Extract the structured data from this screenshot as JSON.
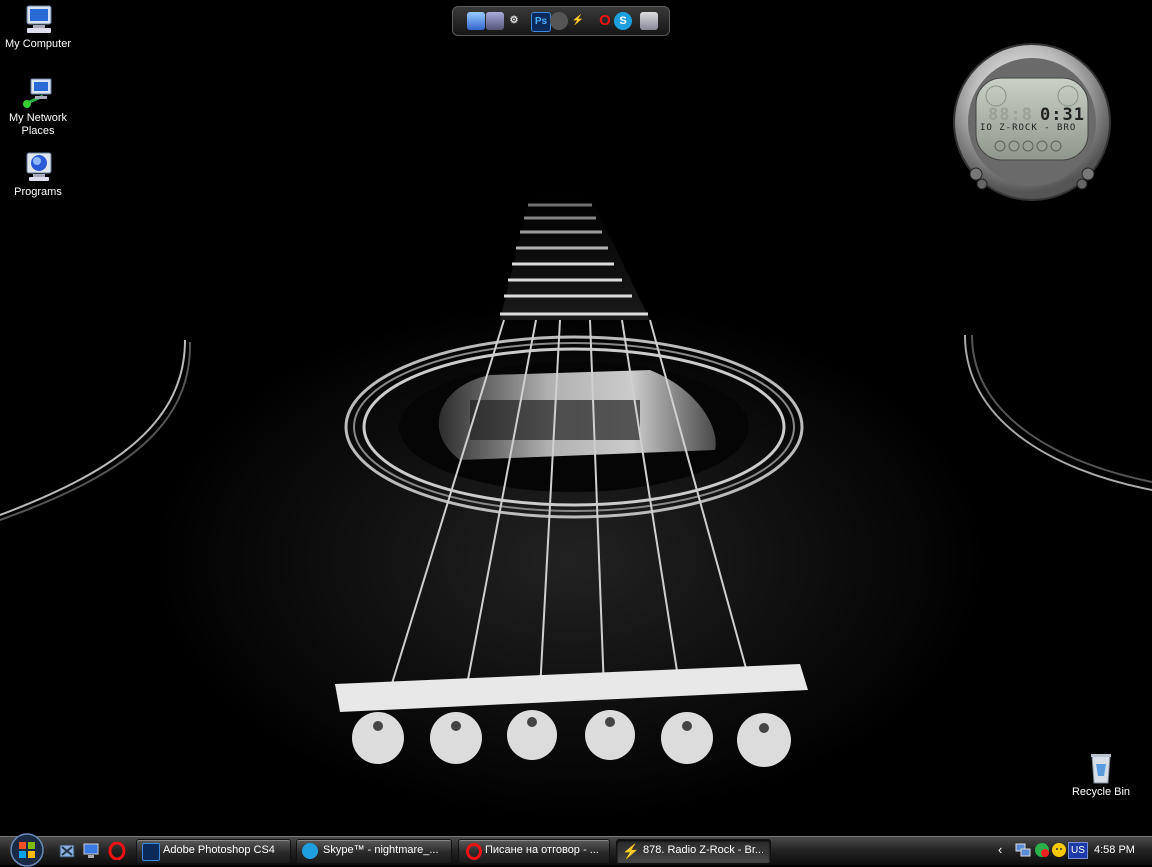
{
  "desktop": {
    "icons": [
      {
        "label": "My Computer",
        "icon": "computer-icon"
      },
      {
        "label": "My Network\nPlaces",
        "label_line1": "My Network",
        "label_line2": "Places",
        "icon": "network-places-icon"
      },
      {
        "label": "Programs",
        "icon": "programs-icon"
      },
      {
        "label": "Recycle Bin",
        "icon": "recycle-bin-icon"
      }
    ],
    "wallpaper": "acoustic guitar, black and white"
  },
  "dock": {
    "items": [
      "network-icon",
      "windows-icon",
      "settings-gear-icon",
      "photoshop-icon",
      "media-icon",
      "power-icon",
      "opera-icon",
      "skype-icon",
      "recycle-bin-icon"
    ],
    "photoshop_label": "Ps"
  },
  "player": {
    "time": "0:31",
    "time_ghost": "88:8",
    "track": "IO Z-ROCK - BRO"
  },
  "taskbar": {
    "quick_launch": [
      "show-desktop-icon",
      "monitor-icon",
      "opera-icon"
    ],
    "tasks": [
      {
        "label": "Adobe Photoshop CS4",
        "icon": "photoshop-icon",
        "active": false
      },
      {
        "label": "Skype™ - nightmare_...",
        "icon": "skype-icon",
        "active": false
      },
      {
        "label": "Писане на отговор - ...",
        "icon": "opera-icon",
        "active": false
      },
      {
        "label": "878. Radio Z-Rock - Br...",
        "icon": "winamp-icon",
        "active": true
      }
    ],
    "tray": {
      "language": "US",
      "clock": "4:58 PM"
    }
  },
  "colors": {
    "background": "#000000",
    "taskbar": "#262626",
    "accent_blue": "#1b3aa8"
  }
}
